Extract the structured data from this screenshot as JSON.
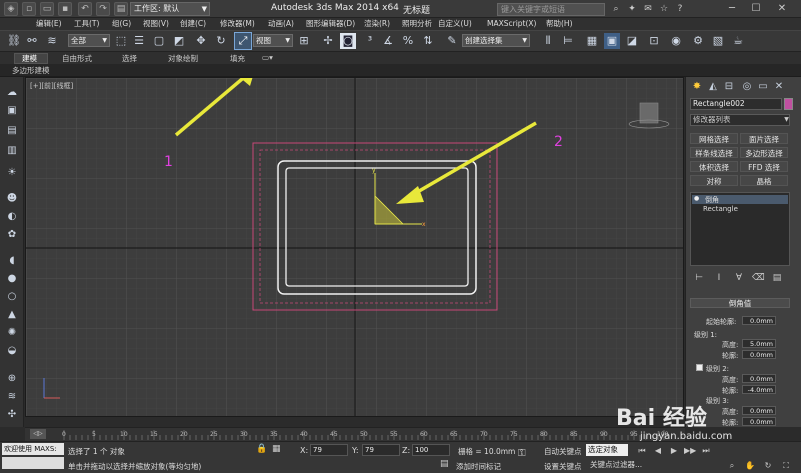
{
  "titlebar": {
    "workspace_label": "工作区: 默认",
    "app_title": "Autodesk 3ds Max  2014 x64",
    "doc_title": "无标题",
    "search_placeholder": "键入关键字或短语"
  },
  "menu": [
    "编辑(E)",
    "工具(T)",
    "组(G)",
    "视图(V)",
    "创建(C)",
    "修改器(M)",
    "动画(A)",
    "图形编辑器(D)",
    "渲染(R)",
    "照明分析",
    "自定义(U)",
    "MAXScript(X)",
    "帮助(H)"
  ],
  "toolbar": {
    "filter_value": "全部",
    "refcoord_value": "视图",
    "selset_value": "创建选择集"
  },
  "ribbon": {
    "tabs": [
      "建模",
      "自由形式",
      "选择",
      "对象绘制",
      "填充"
    ],
    "sub_label": "多边形建模"
  },
  "viewport": {
    "label": "[+][前][线框]"
  },
  "command_panel": {
    "object_name": "Rectangle002",
    "modifier_list": "修改器列表",
    "buttons": [
      "网格选择",
      "面片选择",
      "样条线选择",
      "多边形选择",
      "体积选择",
      "FFD 选择",
      "对称",
      "晶格"
    ],
    "stack_items": [
      "倒角",
      "Rectangle"
    ],
    "rollout_title": "倒角值",
    "start_outline_label": "起始轮廓:",
    "start_outline_value": "0.0mm",
    "level1_label": "级别 1:",
    "height_label": "高度:",
    "outline_label": "轮廓:",
    "level1_height": "5.0mm",
    "level1_outline": "0.0mm",
    "level2_label": "级别 2:",
    "level2_height": "0.0mm",
    "level2_outline": "-4.0mm",
    "level3_label": "级别 3:",
    "level3_height": "0.0mm",
    "level3_outline": "0.0mm"
  },
  "timeslider": {
    "ticks": [
      "0",
      "5",
      "10",
      "15",
      "20",
      "25",
      "30",
      "35",
      "40",
      "45",
      "50",
      "55",
      "60",
      "65",
      "70",
      "75",
      "80",
      "85",
      "90",
      "95",
      "100"
    ]
  },
  "statusbar": {
    "maxscript_label": "欢迎使用 MAXS:",
    "status_message": "选择了 1 个 对象",
    "prompt_message": "单击并拖动以选择并缩放对象(等均匀地)",
    "x_label": "X:",
    "x_value": "79",
    "y_label": "Y:",
    "y_value": "79",
    "z_label": "Z:",
    "z_value": "100",
    "grid_label": "栅格 = 10.0mm",
    "add_time_tag": "添加时间标记",
    "auto_key": "自动关键点",
    "set_key": "设置关键点",
    "selected_label": "选定对象",
    "key_filters": "关键点过滤器..."
  },
  "annotations": {
    "label_1": "1",
    "label_2": "2"
  },
  "watermark": {
    "text": "Bai 经验",
    "url": "jingyan.baidu.com"
  },
  "colors": {
    "annotation_arrow": "#e8e83a",
    "annotation_number": "#e040e0",
    "selection_bracket": "#d44a7a",
    "gizmo_x": "#ff9b3a",
    "gizmo_y": "#e6e64a"
  }
}
